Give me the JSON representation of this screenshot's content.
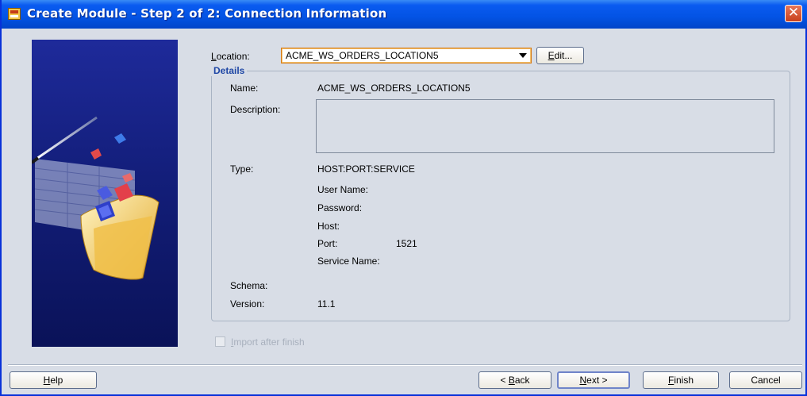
{
  "window": {
    "title": "Create Module - Step 2 of 2: Connection Information",
    "close_glyph": "✕"
  },
  "location": {
    "label_prefix": "",
    "label_mnemonic": "L",
    "label_rest": "ocation:",
    "selected": "ACME_WS_ORDERS_LOCATION5",
    "edit_mnemonic": "E",
    "edit_rest": "dit..."
  },
  "details": {
    "legend": "Details",
    "name_label": "Name:",
    "name_value": "ACME_WS_ORDERS_LOCATION5",
    "description_label": "Description:",
    "description_value": "",
    "type_label": "Type:",
    "type_value": "HOST:PORT:SERVICE",
    "user_name_label": "User Name:",
    "password_label": "Password:",
    "host_label": "Host:",
    "port_label": "Port:",
    "port_value": "1521",
    "service_name_label": "Service Name:",
    "schema_label": "Schema:",
    "version_label": "Version:",
    "version_value": "11.1"
  },
  "import_after_finish": {
    "mnemonic": "I",
    "rest": "mport after finish",
    "checked": false,
    "enabled": false
  },
  "buttons": {
    "help_mnemonic": "H",
    "help_rest": "elp",
    "back_prefix": "< ",
    "back_mnemonic": "B",
    "back_rest": "ack",
    "next_mnemonic": "N",
    "next_rest": "ext >",
    "finish_mnemonic": "F",
    "finish_rest": "inish",
    "cancel_label": "Cancel"
  },
  "colors": {
    "titlebar": "#0353e4",
    "dialog_background": "#d8dde6",
    "legend_text": "#1f47a5",
    "combo_focus_border": "#d67a16"
  },
  "icons": [
    "app-icon",
    "close-icon",
    "dropdown-arrow-icon",
    "wizard-folder-graphic"
  ]
}
